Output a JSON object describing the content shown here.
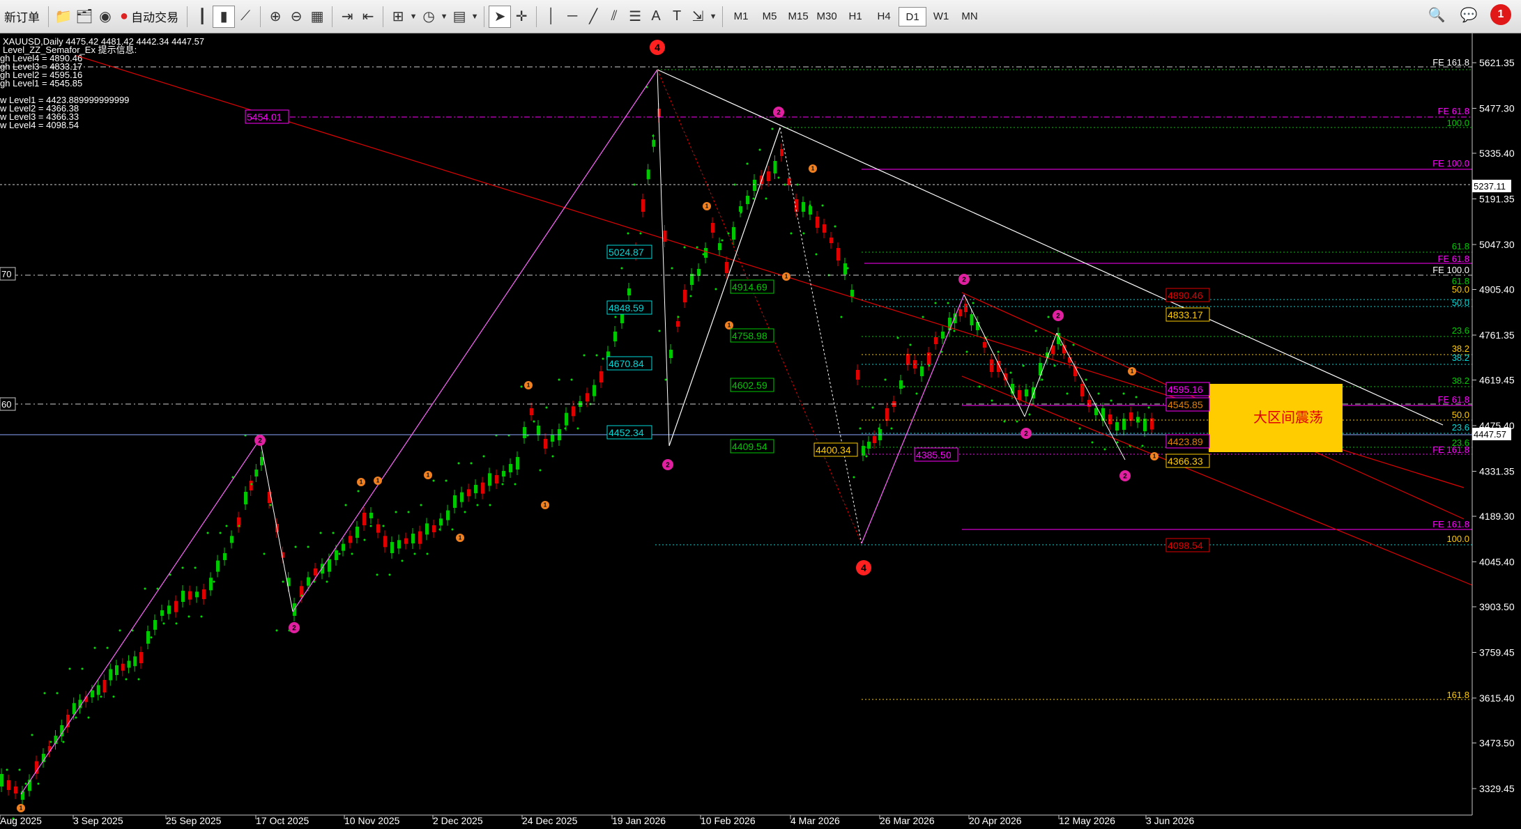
{
  "toolbar": {
    "new_order": "新订单",
    "auto_trade": "自动交易",
    "timeframes": [
      "M1",
      "M5",
      "M15",
      "M30",
      "H1",
      "H4",
      "D1",
      "W1",
      "MN"
    ],
    "active_timeframe": "D1",
    "notification_count": "1"
  },
  "info": {
    "line1": "XAUUSD,Daily  4475.42 4481.42 4442.34 4447.57",
    "line2": "Level_ZZ_Semafor_Ex 提示信息:",
    "line3": "gh Level4 = 4890.46",
    "line4": "gh Level3 = 4833.17",
    "line5": "gh Level2 = 4595.16",
    "line6": "gh Level1 = 4545.85",
    "line7": "w Level1 = 4423.889999999999",
    "line8": "w Level2 = 4366.38",
    "line9": "w Level3 = 4366.33",
    "line10": "w Level4 = 4098.54"
  },
  "price_axis": {
    "labels": [
      "5621.35",
      "5477.30",
      "5335.40",
      "5191.35",
      "5047.30",
      "4905.40",
      "4761.35",
      "4619.45",
      "4475.40",
      "4331.35",
      "4189.30",
      "4045.40",
      "3903.50",
      "3759.45",
      "3615.40",
      "3473.50",
      "3329.45"
    ],
    "current_price": "4447.57",
    "line_price": "5237.11"
  },
  "date_axis": {
    "labels": [
      "Aug 2025",
      "3 Sep 2025",
      "25 Sep 2025",
      "17 Oct 2025",
      "10 Nov 2025",
      "2 Dec 2025",
      "24 Dec 2025",
      "19 Jan 2026",
      "10 Feb 2026",
      "4 Mar 2026",
      "26 Mar 2026",
      "20 Apr 2026",
      "12 May 2026",
      "3 Jun 2026"
    ]
  },
  "left_edge": {
    "upper": "70",
    "lower": "60"
  },
  "chart_boxes": {
    "b5454": "5454.01",
    "b5024": "5024.87",
    "b4848": "4848.59",
    "b4670": "4670.84",
    "b4452": "4452.34",
    "b4914": "4914.69",
    "b4758": "4758.98",
    "b4602": "4602.59",
    "b4409": "4409.54",
    "b4400": "4400.34",
    "b4385": "4385.50",
    "b4890": "4890.46",
    "b4833": "4833.17",
    "b4595": "4595.16",
    "b4545": "4545.85",
    "b4423": "4423.89",
    "b4366": "4366.33",
    "b4098": "4098.54"
  },
  "fib_labels": {
    "fe1618_top": "FE 161.8",
    "fe618_a": "FE 61.8",
    "p100_a": "100.0",
    "fe100_a": "FE 100.0",
    "p618_a": "61.8",
    "fe618_b": "FE 61.8",
    "fe100_b": "FE 100.0",
    "p618_b": "61.8",
    "p50_a": "50.0",
    "p50_b": "50.0",
    "p236_a": "23.6",
    "p382_a": "38.2",
    "p382_b": "38.2",
    "p382_c": "38.2",
    "fe618_c": "FE 61.8",
    "p50_c": "50.0",
    "p236_b": "23.6",
    "p236_c": "23.6",
    "fe1618_b": "FE 161.8",
    "fe1618_c": "FE 161.8",
    "p100_b": "100.0",
    "p1618": "161.8"
  },
  "annotation": "大区间震荡",
  "colors": {
    "bull": "#00c800",
    "bear": "#e00000",
    "magenta": "#ff00ff",
    "cyan": "#00d8d8",
    "annotation_bg": "#ffcc00"
  }
}
